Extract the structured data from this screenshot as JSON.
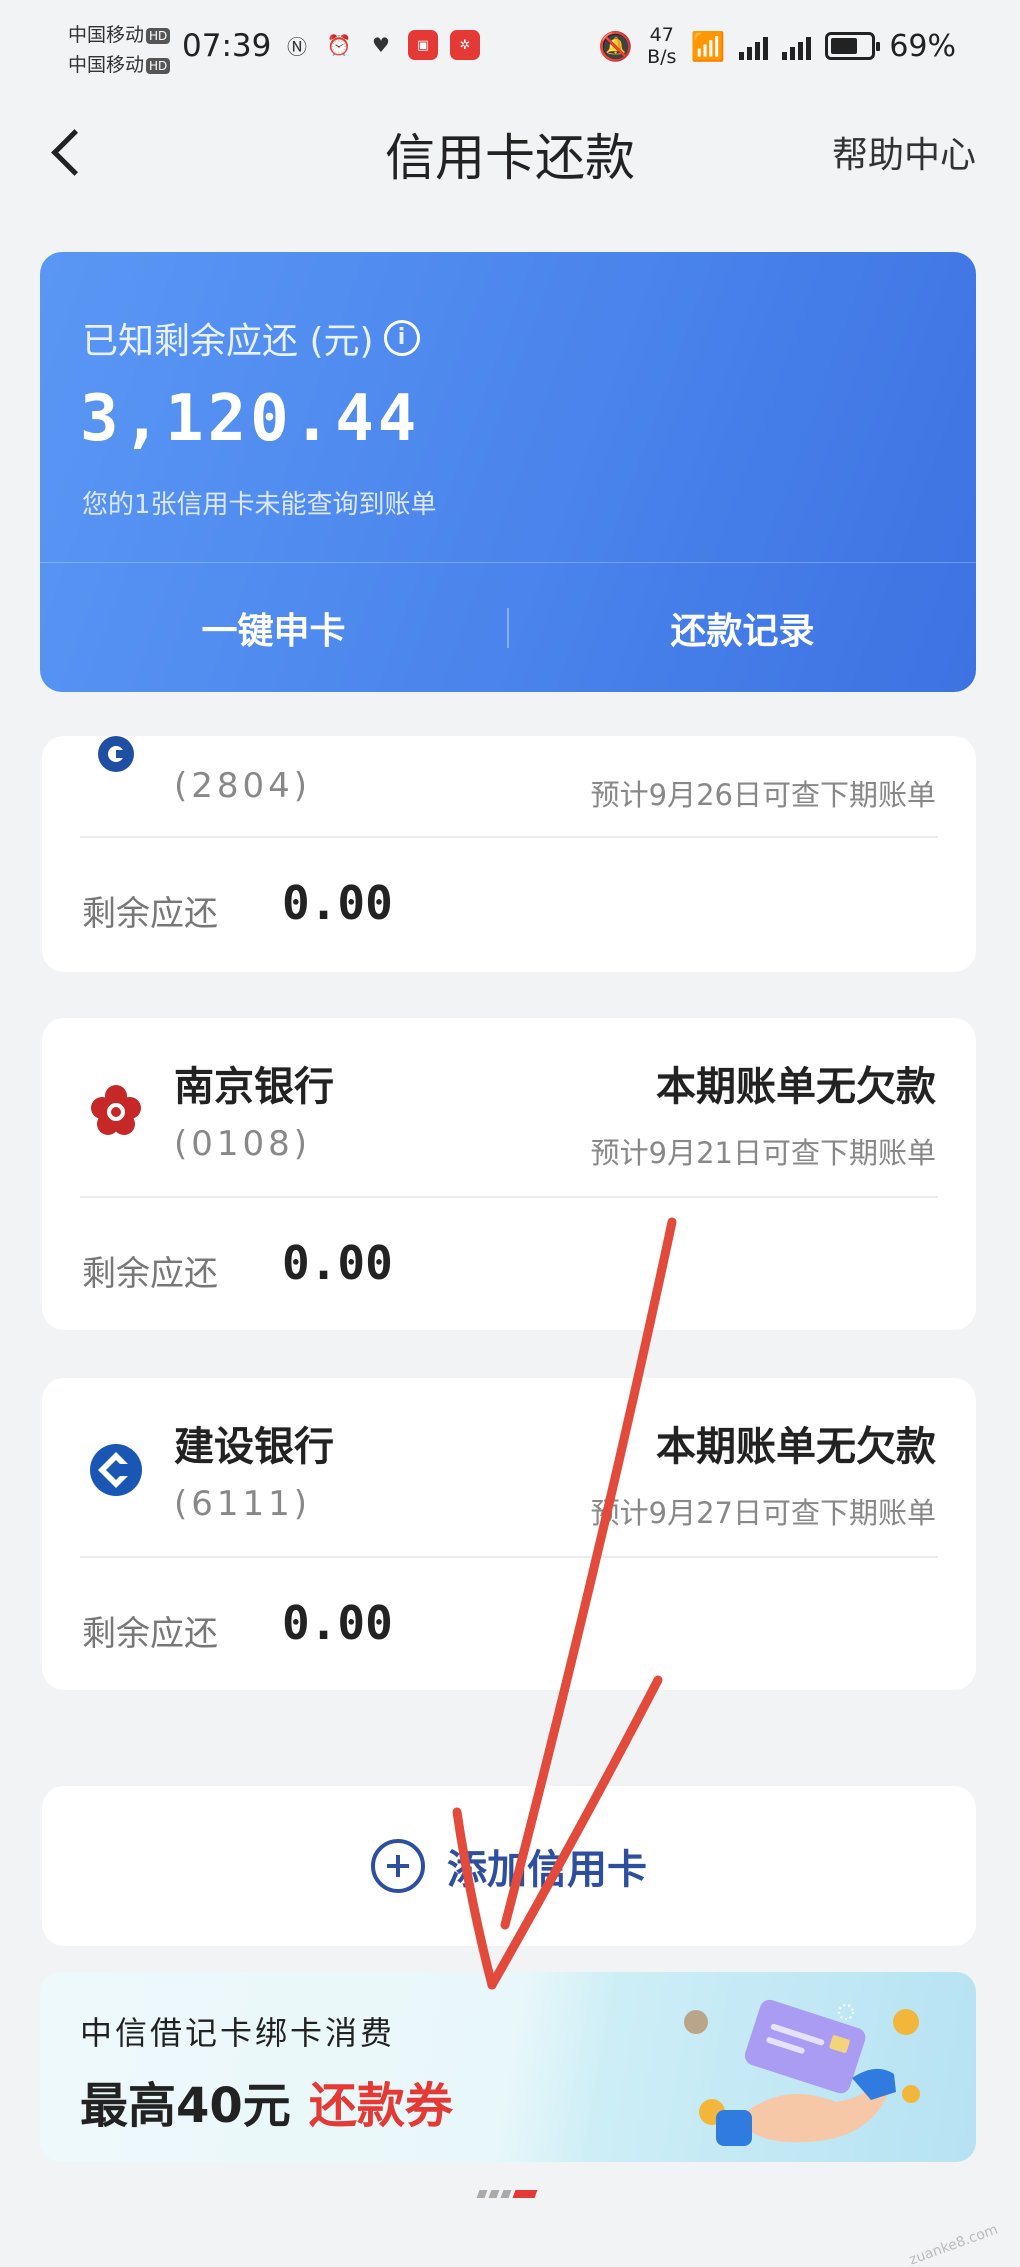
{
  "status_bar": {
    "carrier_1": "中国移动",
    "carrier_2": "中国移动",
    "hd": "HD",
    "time": "07:39",
    "net_speed_value": "47",
    "net_speed_unit": "B/s",
    "battery": "69%"
  },
  "nav": {
    "title": "信用卡还款",
    "help": "帮助中心"
  },
  "summary": {
    "label": "已知剩余应还 (元)",
    "amount": "3,120.44",
    "note": "您的1张信用卡未能查询到账单",
    "apply_button": "一键申卡",
    "records_button": "还款记录"
  },
  "cards": [
    {
      "name": "",
      "number": "(2804)",
      "status": "",
      "hint": "预计9月26日可查下期账单",
      "remain_label": "剩余应还",
      "remain_value": "0.00",
      "logo": "partial-bank-logo"
    },
    {
      "name": "南京银行",
      "number": "(0108)",
      "status": "本期账单无欠款",
      "hint": "预计9月21日可查下期账单",
      "remain_label": "剩余应还",
      "remain_value": "0.00",
      "logo": "bank-of-nanjing-logo"
    },
    {
      "name": "建设银行",
      "number": "(6111)",
      "status": "本期账单无欠款",
      "hint": "预计9月27日可查下期账单",
      "remain_label": "剩余应还",
      "remain_value": "0.00",
      "logo": "ccb-logo"
    }
  ],
  "add_card": {
    "label": "添加信用卡"
  },
  "promo": {
    "line1": "中信借记卡绑卡消费",
    "line2_prefix": "最高40元",
    "line2_highlight": "还款券"
  },
  "colors": {
    "summary_blue": "#4a84ec",
    "accent_red": "#e53935",
    "add_blue": "#2d4f9e"
  }
}
